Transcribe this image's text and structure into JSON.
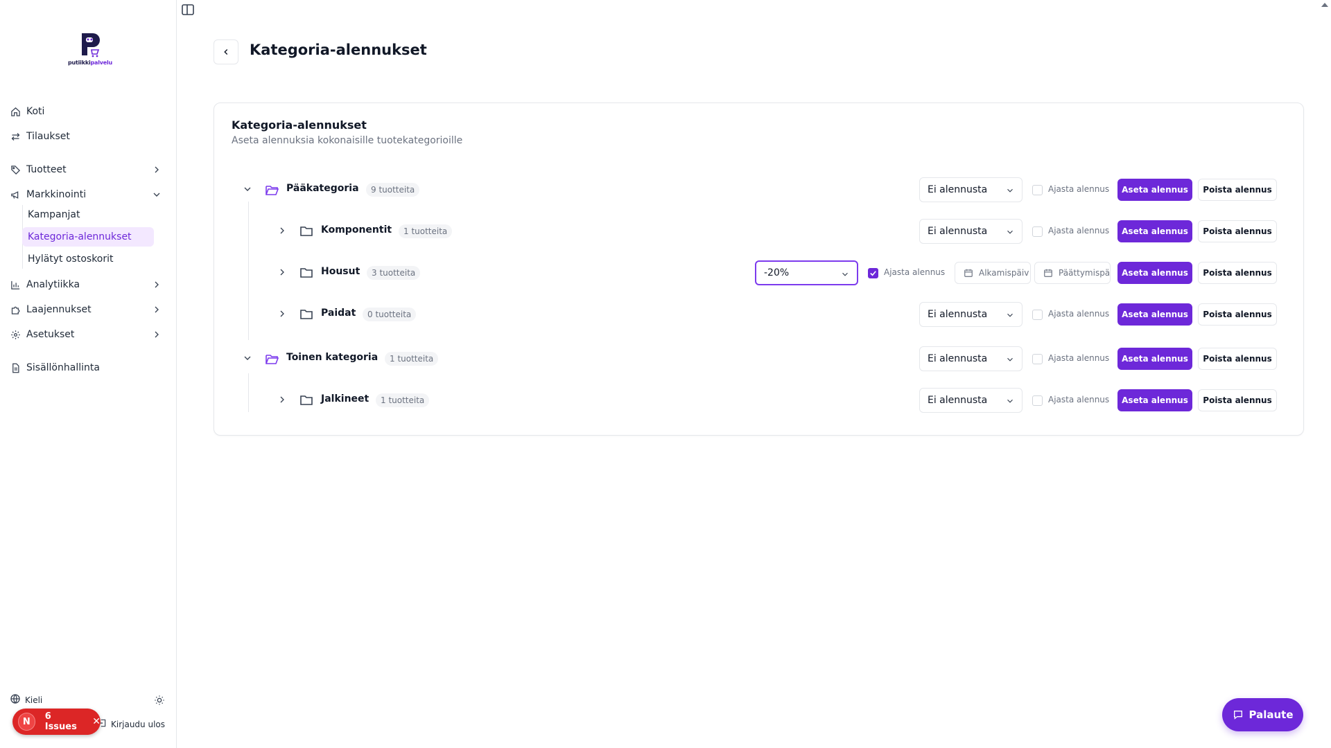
{
  "brand": {
    "name_part1": "putiikki",
    "name_part2": "palvelu"
  },
  "sidebar": {
    "items": [
      {
        "label": "Koti",
        "icon": "home-icon"
      },
      {
        "label": "Tilaukset",
        "icon": "arrows-exchange-icon"
      },
      {
        "label": "Tuotteet",
        "icon": "tag-icon"
      },
      {
        "label": "Markkinointi",
        "icon": "megaphone-icon"
      },
      {
        "label": "Analytiikka",
        "icon": "bar-chart-icon"
      },
      {
        "label": "Laajennukset",
        "icon": "puzzle-icon"
      },
      {
        "label": "Asetukset",
        "icon": "gear-icon"
      },
      {
        "label": "Sisällönhallinta",
        "icon": "document-icon"
      }
    ],
    "marketing_sub": [
      {
        "label": "Kampanjat",
        "active": false
      },
      {
        "label": "Kategoria-alennukset",
        "active": true
      },
      {
        "label": "Hylätyt ostoskorit",
        "active": false
      }
    ],
    "language_label": "Kieli",
    "logout_label": "Kirjaudu ulos"
  },
  "issues_badge": {
    "letter": "N",
    "label": "6 Issues"
  },
  "header": {
    "title": "Kategoria-alennukset"
  },
  "card": {
    "title": "Kategoria-alennukset",
    "subtitle": "Aseta alennuksia kokonaisille tuotekategorioille"
  },
  "actions": {
    "schedule_label": "Ajasta alennus",
    "set_label": "Aseta alennus",
    "remove_label": "Poista alennus",
    "start_placeholder": "Alkamispäiv",
    "end_placeholder": "Päättymispäi"
  },
  "categories": [
    {
      "name": "Pääkategoria",
      "count": "9 tuotteita",
      "level": 0,
      "expanded": true,
      "discount": "Ei alennusta",
      "scheduled": false
    },
    {
      "name": "Komponentit",
      "count": "1 tuotteita",
      "level": 1,
      "expanded": false,
      "discount": "Ei alennusta",
      "scheduled": false
    },
    {
      "name": "Housut",
      "count": "3 tuotteita",
      "level": 1,
      "expanded": false,
      "discount": "-20%",
      "scheduled": true
    },
    {
      "name": "Paidat",
      "count": "0 tuotteita",
      "level": 1,
      "expanded": false,
      "discount": "Ei alennusta",
      "scheduled": false
    },
    {
      "name": "Toinen kategoria",
      "count": "1 tuotteita",
      "level": 0,
      "expanded": true,
      "discount": "Ei alennusta",
      "scheduled": false
    },
    {
      "name": "Jalkineet",
      "count": "1 tuotteita",
      "level": 1,
      "expanded": false,
      "discount": "Ei alennusta",
      "scheduled": false
    }
  ],
  "feedback_button": "Palaute",
  "colors": {
    "accent": "#6d28d9",
    "accent_light": "#f3e8ff",
    "danger": "#dc2626"
  }
}
